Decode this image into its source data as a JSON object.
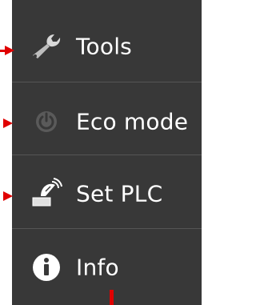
{
  "menu": {
    "items": [
      {
        "label": "Tools",
        "icon": "wrench-icon",
        "enabled": true
      },
      {
        "label": "Eco mode",
        "icon": "power-icon",
        "enabled": false
      },
      {
        "label": "Set PLC",
        "icon": "satellite-dish-icon",
        "enabled": true
      },
      {
        "label": "Info",
        "icon": "info-icon",
        "enabled": true
      }
    ]
  },
  "colors": {
    "menu_background": "#383838",
    "divider": "#555555",
    "label_text": "#ffffff",
    "annotation_red": "#e00000"
  }
}
